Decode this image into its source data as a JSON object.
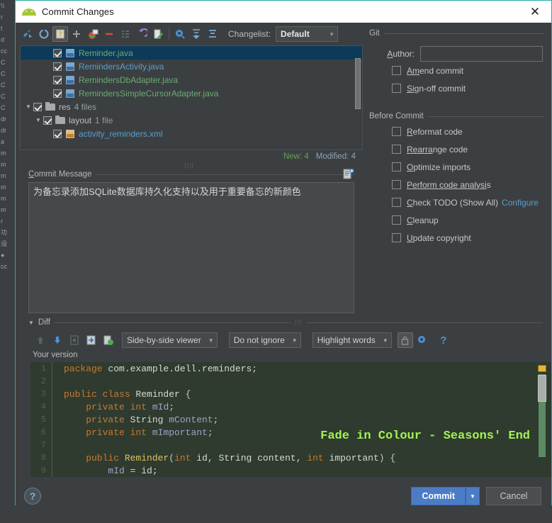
{
  "window": {
    "title": "Commit Changes",
    "app_icon": "android-icon",
    "close_label": "✕"
  },
  "toolbar": {
    "buttons": [
      {
        "name": "show-diff-icon",
        "glyph": "❖"
      },
      {
        "name": "refresh-icon",
        "glyph": "↻"
      },
      {
        "name": "group-by-directory-icon",
        "glyph": "▤",
        "pressed": true
      },
      {
        "name": "add-icon",
        "glyph": "+"
      },
      {
        "name": "move-to-changelist-icon",
        "glyph": "⬛"
      },
      {
        "name": "delete-icon",
        "glyph": "−"
      },
      {
        "name": "collapse-icon",
        "glyph": "☰"
      },
      {
        "name": "revert-icon",
        "glyph": "↩"
      },
      {
        "name": "edit-source-icon",
        "glyph": "✎"
      },
      {
        "name": "settings-icon",
        "glyph": "⚙"
      },
      {
        "name": "expand-all-icon",
        "glyph": "⤓"
      },
      {
        "name": "collapse-all-icon",
        "glyph": "⤒"
      }
    ],
    "changelist_label": "Changelist:",
    "changelist_value": "Default"
  },
  "file_tree": {
    "rows": [
      {
        "indent": 3,
        "checked": true,
        "icon": "java-file-icon",
        "name": "Reminder.java",
        "color": "green",
        "selected": true,
        "count": ""
      },
      {
        "indent": 3,
        "checked": true,
        "icon": "java-file-icon",
        "name": "RemindersActivity.java",
        "color": "blue",
        "selected": false,
        "count": ""
      },
      {
        "indent": 3,
        "checked": true,
        "icon": "java-file-icon",
        "name": "RemindersDbAdapter.java",
        "color": "green",
        "selected": false,
        "count": ""
      },
      {
        "indent": 3,
        "checked": true,
        "icon": "java-file-icon",
        "name": "RemindersSimpleCursorAdapter.java",
        "color": "green",
        "selected": false,
        "count": ""
      },
      {
        "indent": 1,
        "checked": true,
        "icon": "folder-icon",
        "name": "res",
        "color": "plain",
        "selected": false,
        "count": "4 files",
        "twisty": true
      },
      {
        "indent": 2,
        "checked": true,
        "icon": "folder-icon",
        "name": "layout",
        "color": "plain",
        "selected": false,
        "count": "1 file",
        "twisty": true
      },
      {
        "indent": 3,
        "checked": true,
        "icon": "xml-file-icon",
        "name": "activity_reminders.xml",
        "color": "blue",
        "selected": false,
        "count": ""
      }
    ]
  },
  "counts": {
    "new_label": "New: 4",
    "modified_label": "Modified: 4"
  },
  "commit_message": {
    "label_prefix": "C",
    "label": "ommit Message",
    "value": "为备忘录添加SQLite数据库持久化支持以及用于重要备忘的新颜色",
    "placeholder": "",
    "icon": "new-message-icon"
  },
  "git_panel": {
    "group_title": "Git",
    "author_label_prefix": "A",
    "author_label": "uthor:",
    "author_value": "",
    "author_placeholder": "",
    "options": [
      {
        "label_prefix": "Am",
        "label": "end commit",
        "checked": false,
        "name": "amend-commit"
      },
      {
        "label_prefix": "Sig",
        "label": "n-off commit",
        "checked": false,
        "name": "sign-off-commit"
      }
    ]
  },
  "before_commit": {
    "group_title": "Before Commit",
    "options": [
      {
        "label_prefix": "R",
        "label": "eformat code",
        "checked": false,
        "name": "reformat-code"
      },
      {
        "label_prefix": "Rearra",
        "label": "nge code",
        "checked": false,
        "name": "rearrange-code"
      },
      {
        "label_prefix": "O",
        "label": "ptimize imports",
        "checked": false,
        "name": "optimize-imports"
      },
      {
        "label_prefix": "Perform code analysi",
        "label": "s",
        "checked": false,
        "name": "perform-code-analysis"
      },
      {
        "label_prefix": "C",
        "label": "heck TODO (Show All)",
        "checked": false,
        "name": "check-todo",
        "link": "Configure"
      },
      {
        "label_prefix": "C",
        "label": "leanup",
        "checked": false,
        "name": "cleanup"
      },
      {
        "label_prefix": "U",
        "label": "pdate copyright",
        "checked": false,
        "name": "update-copyright"
      }
    ]
  },
  "diff": {
    "title": "Diff",
    "toolbar_icons": [
      {
        "name": "previous-difference-icon",
        "glyph": "↑"
      },
      {
        "name": "next-difference-icon",
        "glyph": "↓"
      },
      {
        "name": "accept-left-icon",
        "glyph": "⬚"
      },
      {
        "name": "append-icon",
        "glyph": "⬒"
      },
      {
        "name": "annotate-icon",
        "glyph": "☰"
      }
    ],
    "viewer_mode": "Side-by-side viewer",
    "whitespace_mode": "Do not ignore",
    "highlight_mode": "Highlight words",
    "lock_icon": "lock-icon",
    "settings_icon": "gear-icon",
    "help_icon": "question-icon",
    "version_label": "Your version"
  },
  "code": {
    "lines": [
      {
        "n": "1",
        "tokens": [
          {
            "t": "package",
            "c": "kw"
          },
          {
            "t": " com.example.dell.reminders",
            "c": "id"
          },
          {
            "t": ";",
            "c": "pun"
          }
        ]
      },
      {
        "n": "2",
        "tokens": []
      },
      {
        "n": "3",
        "tokens": [
          {
            "t": "public class ",
            "c": "kw"
          },
          {
            "t": "Reminder",
            "c": "id"
          },
          {
            "t": " {",
            "c": "pun"
          }
        ]
      },
      {
        "n": "4",
        "tokens": [
          {
            "t": "    private ",
            "c": "kw"
          },
          {
            "t": "int ",
            "c": "kw"
          },
          {
            "t": "mId",
            "c": "fld"
          },
          {
            "t": ";",
            "c": "pun"
          }
        ]
      },
      {
        "n": "5",
        "tokens": [
          {
            "t": "    private ",
            "c": "kw"
          },
          {
            "t": "String ",
            "c": "id"
          },
          {
            "t": "mContent",
            "c": "fld"
          },
          {
            "t": ";",
            "c": "pun"
          }
        ]
      },
      {
        "n": "6",
        "tokens": [
          {
            "t": "    private ",
            "c": "kw"
          },
          {
            "t": "int ",
            "c": "kw"
          },
          {
            "t": "mImportant",
            "c": "fld"
          },
          {
            "t": ";",
            "c": "pun"
          }
        ]
      },
      {
        "n": "7",
        "tokens": []
      },
      {
        "n": "8",
        "tokens": [
          {
            "t": "    public ",
            "c": "kw"
          },
          {
            "t": "Reminder",
            "c": "cls"
          },
          {
            "t": "(",
            "c": "pun"
          },
          {
            "t": "int ",
            "c": "kw"
          },
          {
            "t": "id, String content, ",
            "c": "id"
          },
          {
            "t": "int ",
            "c": "kw"
          },
          {
            "t": "important",
            "c": "id"
          },
          {
            "t": ") {",
            "c": "pun"
          }
        ]
      },
      {
        "n": "9",
        "tokens": [
          {
            "t": "        mId ",
            "c": "fld"
          },
          {
            "t": "= id;",
            "c": "id"
          }
        ]
      }
    ]
  },
  "watermark": "Fade in Colour - Seasons' End",
  "footer": {
    "help_label": "?",
    "commit_label": "Commit",
    "commit_dropdown": "▼",
    "cancel_label": "Cancel"
  },
  "background_ide": {
    "lines": [
      "\\\\",
      "",
      "r",
      "t",
      "",
      "d",
      "",
      "cc",
      "",
      "C",
      "C",
      "C",
      "C",
      "C",
      "",
      "dr",
      "dr",
      "a",
      "m",
      "m",
      "m",
      "m",
      "m",
      "m",
      "r",
      "功",
      "设",
      "",
      "",
      "●",
      "cc"
    ]
  },
  "colors": {
    "accent": "#4d7cc7",
    "window_border": "#2aa8a8",
    "dialog_bg": "#3c3f41",
    "selection": "#0d3a58",
    "new_count": "#6a9e55",
    "link": "#5b9ec9",
    "diff_added_bg": "#2e3b2e",
    "watermark": "#a3f252"
  }
}
